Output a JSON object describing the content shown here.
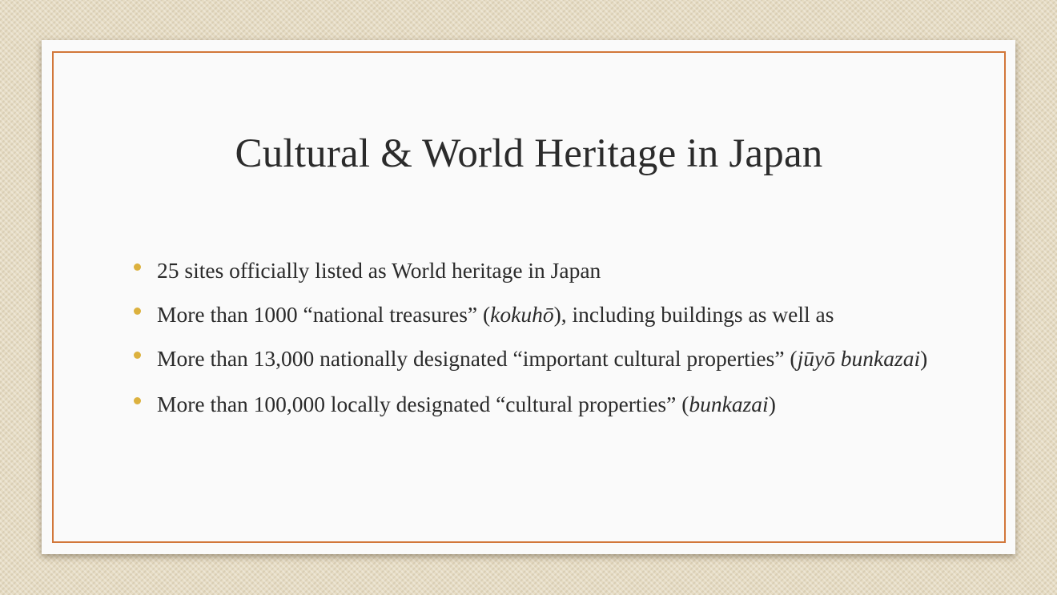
{
  "slide": {
    "title": "Cultural & World Heritage in Japan",
    "bullets": [
      {
        "text": "25 sites officially listed as World heritage in Japan"
      },
      {
        "before": "More than 1000 “national treasures” (",
        "term": "kokuhō",
        "after": "), including buildings as well as"
      },
      {
        "before": "More than 13,000 nationally designated “important cultural properties” (",
        "term": "jūyō bunkazai",
        "after": ")"
      },
      {
        "before": "More than 100,000 locally designated “cultural properties” (",
        "term": "bunkazai",
        "after": ")"
      }
    ]
  },
  "colors": {
    "frame_border": "#d2773a",
    "bullet": "#dcb13e",
    "text": "#2b2b2b",
    "card_background": "#fafafa",
    "page_background": "#e6dcc4"
  }
}
